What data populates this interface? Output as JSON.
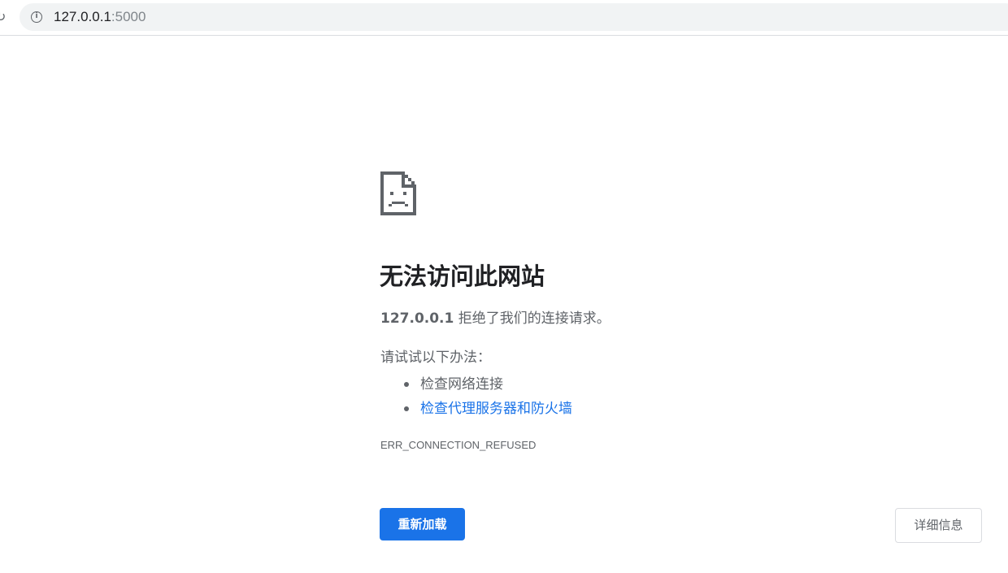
{
  "browser": {
    "reload_icon": "reload-icon",
    "reload_glyph": "↻",
    "info_icon": "info-icon",
    "info_glyph": "i",
    "url_host": "127.0.0.1",
    "url_port": ":5000"
  },
  "error_page": {
    "icon": "sad-page-icon",
    "title": "无法访问此网站",
    "summary_host": "127.0.0.1",
    "summary_text": " 拒绝了我们的连接请求。",
    "suggestions_heading": "请试试以下办法：",
    "suggestions": [
      {
        "label": "检查网络连接",
        "is_link": false
      },
      {
        "label": "检查代理服务器和防火墙",
        "is_link": true
      }
    ],
    "error_code": "ERR_CONNECTION_REFUSED",
    "reload_button": "重新加载",
    "details_button": "详细信息"
  },
  "colors": {
    "accent": "#1a73e8",
    "text_primary": "#202124",
    "text_secondary": "#5f6368",
    "omnibox_bg": "#f1f3f4"
  }
}
